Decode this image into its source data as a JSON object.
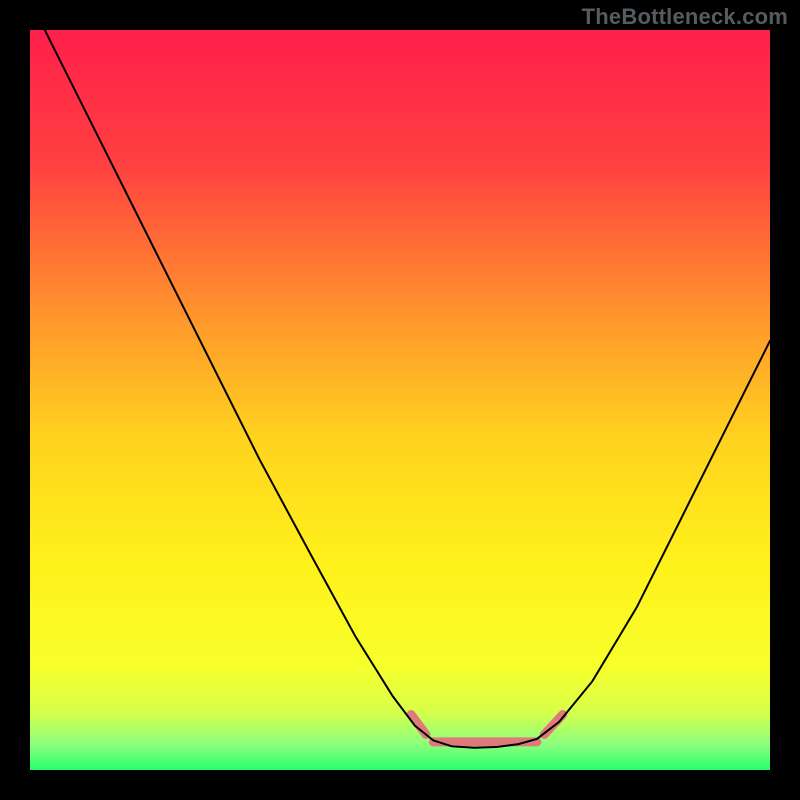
{
  "watermark": "TheBottleneck.com",
  "chart_data": {
    "type": "line",
    "title": "",
    "xlabel": "",
    "ylabel": "",
    "xlim": [
      0,
      100
    ],
    "ylim": [
      0,
      100
    ],
    "background_gradient": {
      "stops": [
        {
          "offset": 0.0,
          "color": "#ff1f4b"
        },
        {
          "offset": 0.18,
          "color": "#ff4040"
        },
        {
          "offset": 0.38,
          "color": "#ff932d"
        },
        {
          "offset": 0.55,
          "color": "#ffd21f"
        },
        {
          "offset": 0.72,
          "color": "#fff11a"
        },
        {
          "offset": 0.86,
          "color": "#f7ff2b"
        },
        {
          "offset": 0.92,
          "color": "#d8ff4a"
        },
        {
          "offset": 0.965,
          "color": "#8cff7c"
        },
        {
          "offset": 1.0,
          "color": "#29ff6e"
        }
      ]
    },
    "series": [
      {
        "name": "bottleneck-curve",
        "stroke": "#000000",
        "stroke_width": 2,
        "points": [
          {
            "x": 2.0,
            "y": 100.0
          },
          {
            "x": 6.0,
            "y": 92.0
          },
          {
            "x": 11.0,
            "y": 82.0
          },
          {
            "x": 17.0,
            "y": 70.0
          },
          {
            "x": 24.0,
            "y": 56.0
          },
          {
            "x": 31.0,
            "y": 42.0
          },
          {
            "x": 38.0,
            "y": 29.0
          },
          {
            "x": 44.0,
            "y": 18.0
          },
          {
            "x": 49.0,
            "y": 10.0
          },
          {
            "x": 52.0,
            "y": 6.0
          },
          {
            "x": 54.5,
            "y": 4.0
          },
          {
            "x": 57.0,
            "y": 3.2
          },
          {
            "x": 60.0,
            "y": 3.0
          },
          {
            "x": 63.0,
            "y": 3.1
          },
          {
            "x": 66.0,
            "y": 3.5
          },
          {
            "x": 68.5,
            "y": 4.2
          },
          {
            "x": 71.5,
            "y": 6.5
          },
          {
            "x": 76.0,
            "y": 12.0
          },
          {
            "x": 82.0,
            "y": 22.0
          },
          {
            "x": 88.0,
            "y": 34.0
          },
          {
            "x": 94.0,
            "y": 46.0
          },
          {
            "x": 100.0,
            "y": 58.0
          }
        ]
      },
      {
        "name": "optimal-zone-markers",
        "stroke": "#e07a7a",
        "stroke_width": 9,
        "segments": [
          [
            {
              "x": 51.5,
              "y": 7.5
            },
            {
              "x": 53.5,
              "y": 4.8
            }
          ],
          [
            {
              "x": 54.5,
              "y": 3.8
            },
            {
              "x": 68.5,
              "y": 3.8
            }
          ],
          [
            {
              "x": 69.5,
              "y": 4.8
            },
            {
              "x": 72.0,
              "y": 7.5
            }
          ]
        ]
      }
    ]
  }
}
